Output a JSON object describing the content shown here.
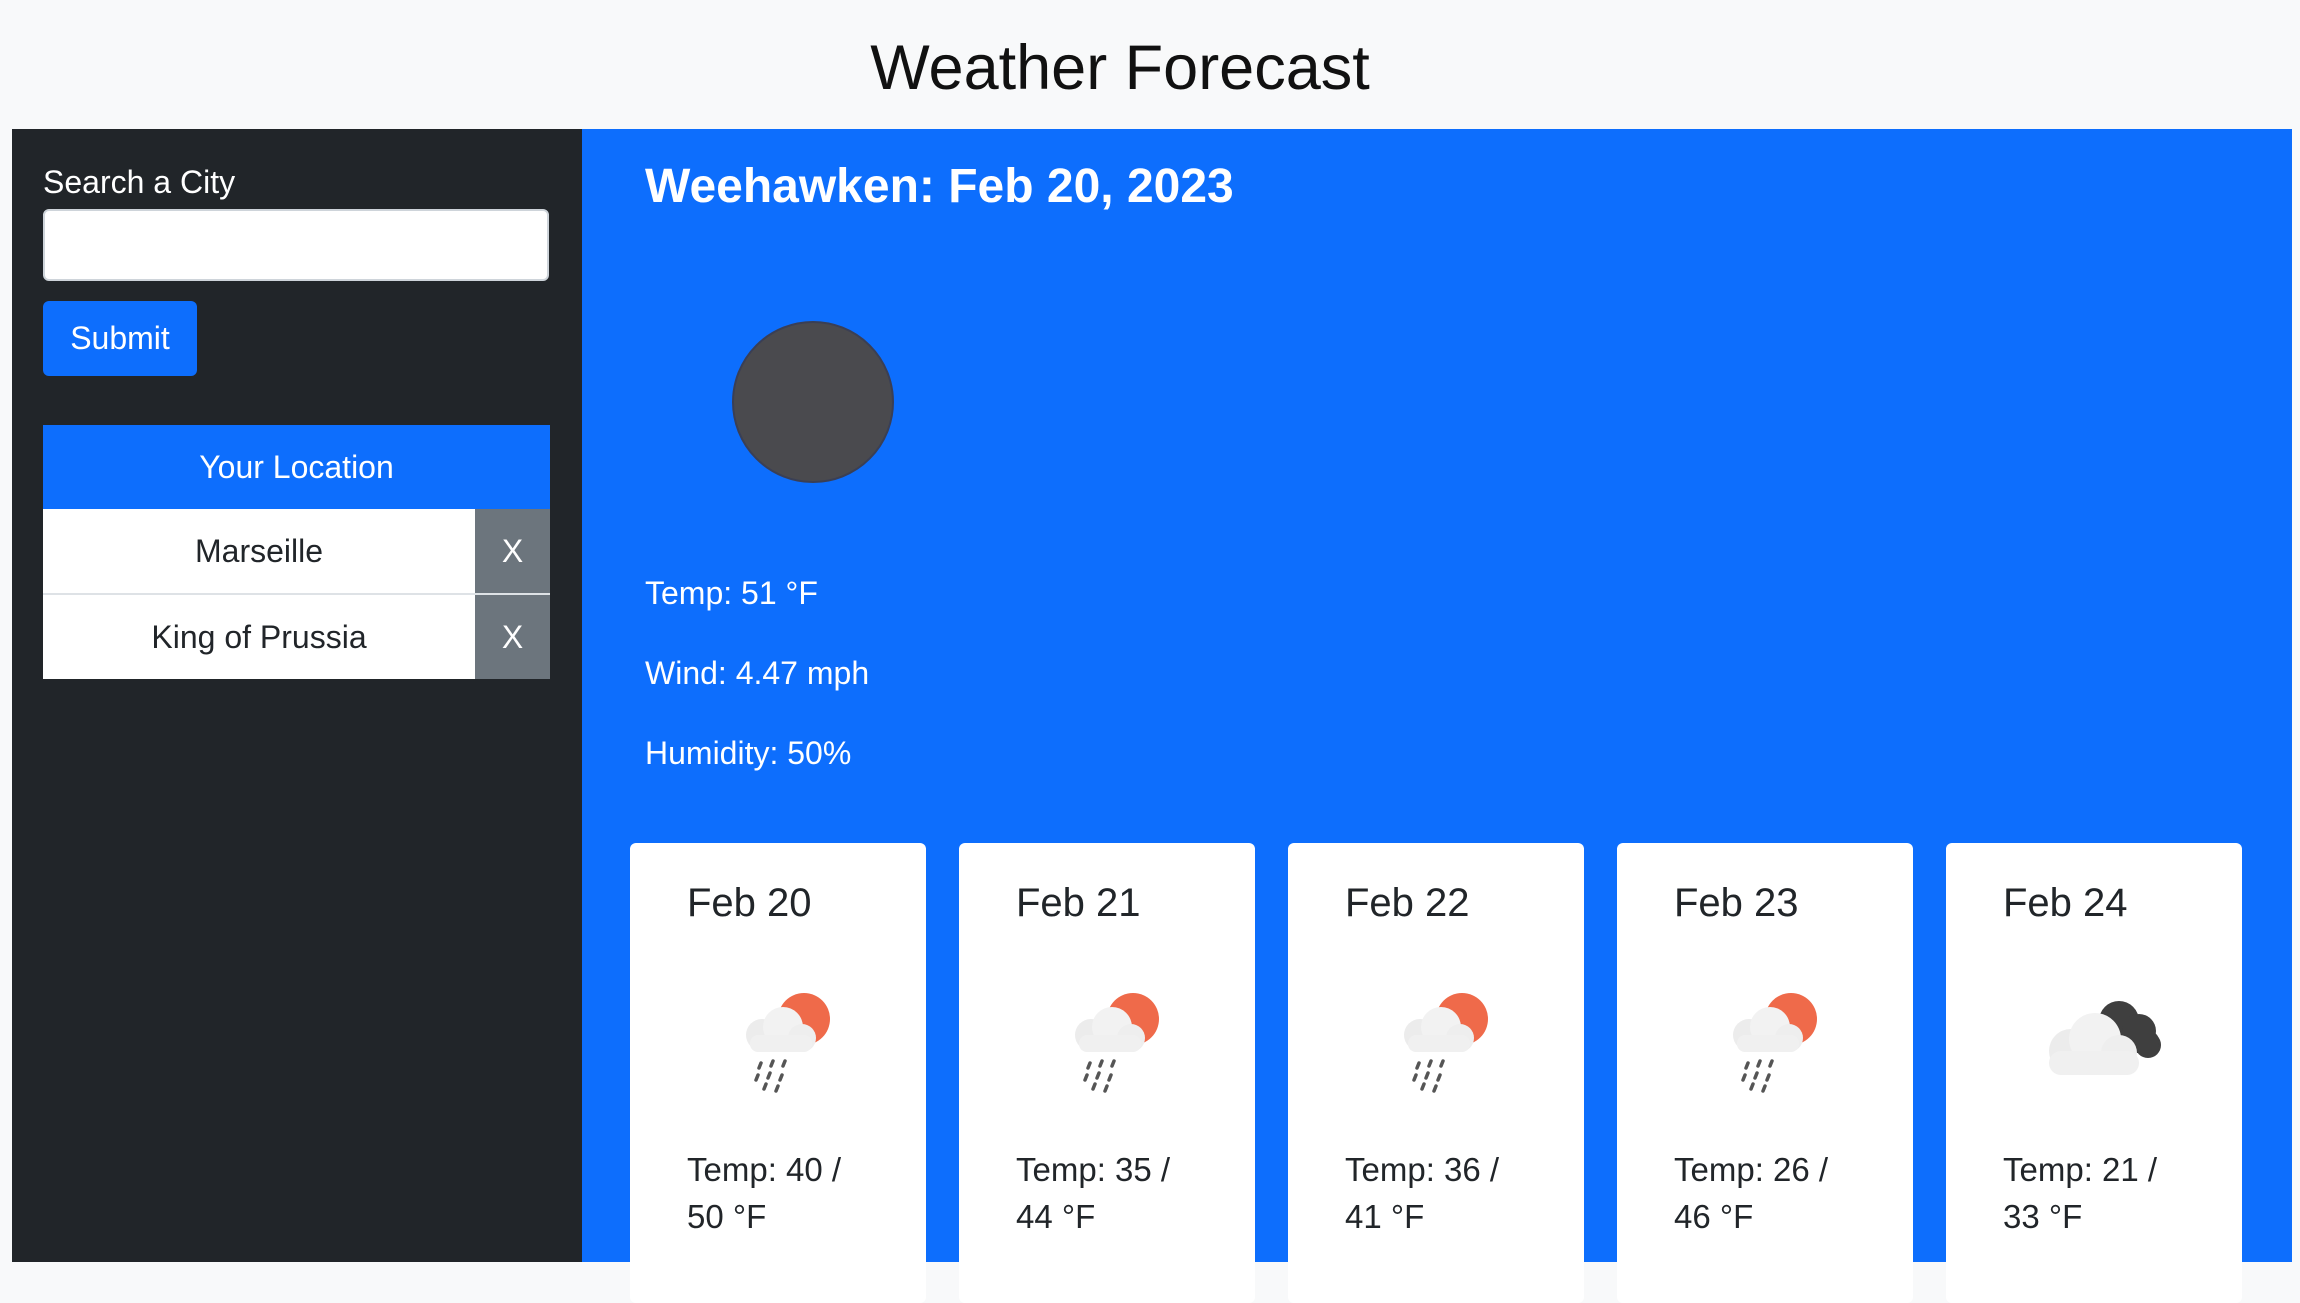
{
  "header": {
    "title": "Weather Forecast"
  },
  "sidebar": {
    "search_label": "Search a City",
    "search_value": "",
    "search_placeholder": "",
    "submit_label": "Submit",
    "your_location_label": "Your Location",
    "cities": [
      {
        "name": "Marseille",
        "remove_label": "X"
      },
      {
        "name": "King of Prussia",
        "remove_label": "X"
      }
    ]
  },
  "current": {
    "title": "Weehawken: Feb 20, 2023",
    "icon": "night-clear-icon",
    "temp": "Temp: 51 °F",
    "wind": "Wind: 4.47 mph",
    "humidity": "Humidity: 50%"
  },
  "forecast": [
    {
      "date": "Feb 20",
      "icon": "rain-sun-icon",
      "temp_line1": "Temp: 40 /",
      "temp_line2": "50 °F"
    },
    {
      "date": "Feb 21",
      "icon": "rain-sun-icon",
      "temp_line1": "Temp: 35 /",
      "temp_line2": "44 °F"
    },
    {
      "date": "Feb 22",
      "icon": "rain-sun-icon",
      "temp_line1": "Temp: 36 /",
      "temp_line2": "41 °F"
    },
    {
      "date": "Feb 23",
      "icon": "rain-sun-icon",
      "temp_line1": "Temp: 26 /",
      "temp_line2": "46 °F"
    },
    {
      "date": "Feb 24",
      "icon": "broken-clouds-icon",
      "temp_line1": "Temp: 21 /",
      "temp_line2": "33 °F"
    }
  ],
  "colors": {
    "primary": "#0d6efd",
    "sidebar_bg": "#212529",
    "remove_btn": "#6c757d",
    "sun": "#ef6a4a",
    "cloud": "#f0f0f0",
    "dark_cloud": "#3f3f3f"
  }
}
